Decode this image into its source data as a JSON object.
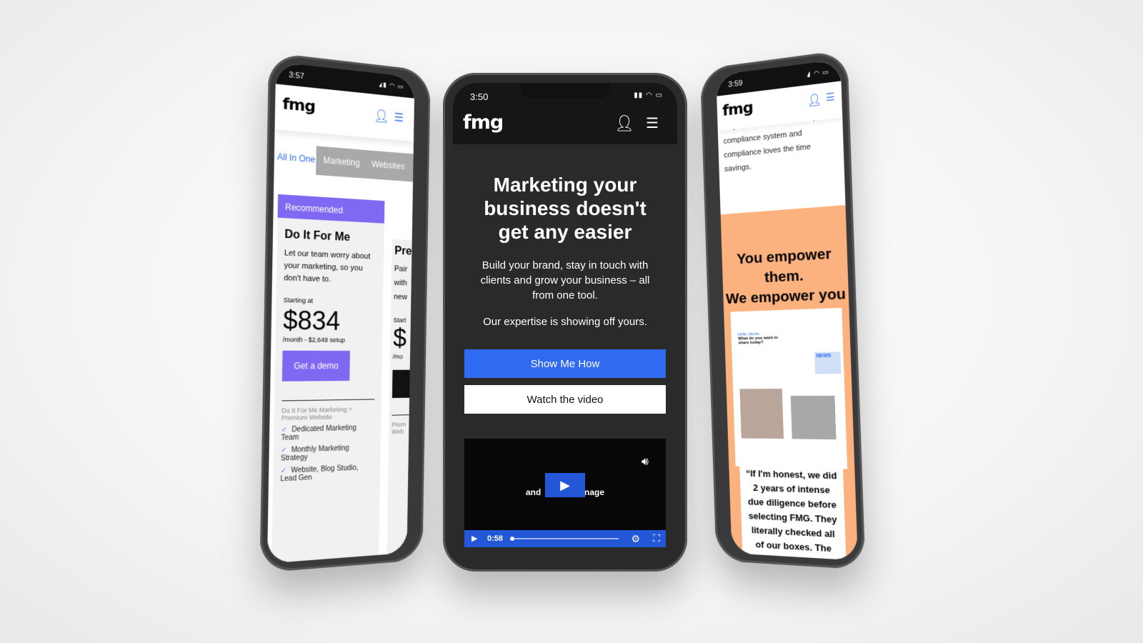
{
  "left_phone": {
    "time": "3:57",
    "logo": "fmg",
    "tabs": [
      "All In One",
      "Marketing",
      "Websites"
    ],
    "badge": "Recommended",
    "plan": {
      "title": "Do It For Me",
      "description": "Let our team worry about your marketing, so you don't have to.",
      "starting_label": "Starting at",
      "price": "$834",
      "price_note": "/month - $2,649 setup",
      "cta": "Get a demo",
      "includes": "Do It For Me Marketing + Premium Website",
      "features": [
        "Dedicated Marketing Team",
        "Monthly Marketing Strategy",
        "Website, Blog Studio, Lead Gen"
      ]
    },
    "next_plan_partial": {
      "title": "Pre",
      "lines": [
        "Pair",
        "with",
        "new"
      ],
      "starting_label": "Start",
      "price": "$",
      "price_note": "/mo",
      "includes": "Prem Web"
    },
    "accent": "#8168f2",
    "link_color": "#2f6bf0"
  },
  "center_phone": {
    "time": "3:50",
    "logo": "fmg",
    "headline": "Marketing your business doesn't get any easier",
    "subtext": "Build your brand, stay in touch with clients and grow your business – all from one tool.",
    "tagline": "Our expertise is showing off yours.",
    "primary_button": "Show Me How",
    "secondary_button": "Watch the video",
    "video": {
      "caption_left": "and",
      "caption_right": "nage",
      "time": "0:58",
      "progress": 0.02
    },
    "accent": "#2f6bf0"
  },
  "right_phone": {
    "time": "3:59",
    "logo": "fmg",
    "intro": "they don't have to use a separate compliance system and compliance loves the time savings.",
    "headline_1": "You empower them.",
    "headline_2": "We empower you",
    "app_preview": {
      "greeting": "Hello Jamie,",
      "question": "What do you want to share today?",
      "news": "NEWS"
    },
    "quote": "“If I'm honest, we did 2 years of intense due diligence before selecting FMG. They literally checked all of our boxes. The feedback",
    "accent": "#fbb27f"
  }
}
